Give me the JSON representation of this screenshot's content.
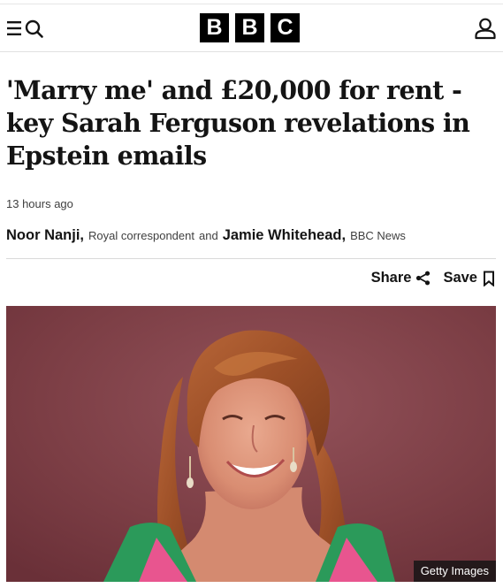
{
  "header": {
    "logo_letters": [
      "B",
      "B",
      "C"
    ],
    "icons": {
      "menu": "menu-icon",
      "search": "search-icon",
      "account": "account-icon"
    }
  },
  "article": {
    "headline": "'Marry me' and £20,000 for rent - key Sarah Ferguson revelations in Epstein emails",
    "timestamp": "13 hours ago",
    "byline": {
      "author1": "Noor Nanji,",
      "role1": "Royal correspondent",
      "conjunction": "and",
      "author2": "Jamie Whitehead,",
      "role2": "BBC News"
    },
    "actions": {
      "share_label": "Share",
      "save_label": "Save",
      "share_icon": "share-icon",
      "save_icon": "bookmark-icon"
    },
    "image": {
      "credit": "Getty Images",
      "background_color": "#7a3c42"
    }
  }
}
